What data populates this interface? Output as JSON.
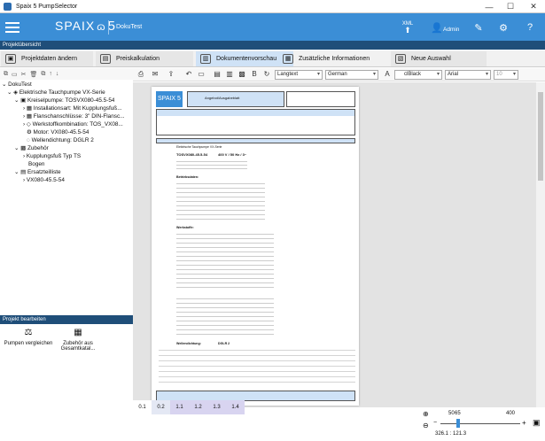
{
  "window": {
    "title": "Spaix 5 PumpSelector",
    "minimize": "—",
    "maximize": "☐",
    "close": "✕"
  },
  "header": {
    "logo_text": "SPAIX",
    "logo_num": "5",
    "project": "DokuTest",
    "xml_label": "XML",
    "admin_label": "Admin"
  },
  "section_project_overview": "Projektübersicht",
  "tabs": [
    {
      "label": "Projektdaten ändern",
      "icon": "cube-icon"
    },
    {
      "label": "Preiskalkulation",
      "icon": "calculator-icon"
    },
    {
      "label": "Dokumentenvorschau",
      "icon": "document-icon"
    },
    {
      "label": "Zusätzliche Informationen",
      "icon": "info-icon"
    },
    {
      "label": "Neue Auswahl",
      "icon": "new-selection-icon"
    }
  ],
  "tree": {
    "root": "DokuTest",
    "n1": "Elektrische Tauchpumpe VX-Serie",
    "n2": "Kreiselpumpe: TOSVX080-45.5-54",
    "n3": "Installationsart: Mit Kupplungsfuß...",
    "n4": "Flanschanschlüsse: 3\" DIN-Flansc...",
    "n5": "Werkstoffkombination: TOS_VX08...",
    "n6": "Motor: VX080-45.5-54",
    "n7": "Wellendichtung: DGLR 2",
    "n8": "Zubehör",
    "n9": "Kupplungsfuß Typ TS",
    "n10": "Bogen",
    "n11": "Ersatzteilliste",
    "n12": "VX080-45.5-54"
  },
  "project_edit": {
    "title": "Projekt bearbeiten",
    "compare": "Pumpen vergleichen",
    "from_set": "Zubehör aus Gesamtkatal..."
  },
  "doc_toolbar": {
    "style": "Langtext",
    "language": "German",
    "color": "clBlack",
    "font": "Arial",
    "size": "10"
  },
  "doc": {
    "header_title": "Angebot/Ausgabeblatt",
    "pump": "TOSVX080-45.5-54",
    "pump_desc": "400 V / 50 Hz / 3~",
    "group1": "Betriebsdaten:",
    "group2": "Werkstoffe:",
    "group3": "Wellendichtung:",
    "wd": "DGLR 2",
    "pos1": "Elektrische Tauchpumpe VX-Serie"
  },
  "page_tabs": [
    "0.1",
    "0.2",
    "1.1",
    "1.2",
    "1.3",
    "1.4"
  ],
  "zoom": {
    "min": "10",
    "low": "50",
    "mid": "65",
    "max": "400",
    "value": "65",
    "readout": "326.1 : 121.3"
  }
}
